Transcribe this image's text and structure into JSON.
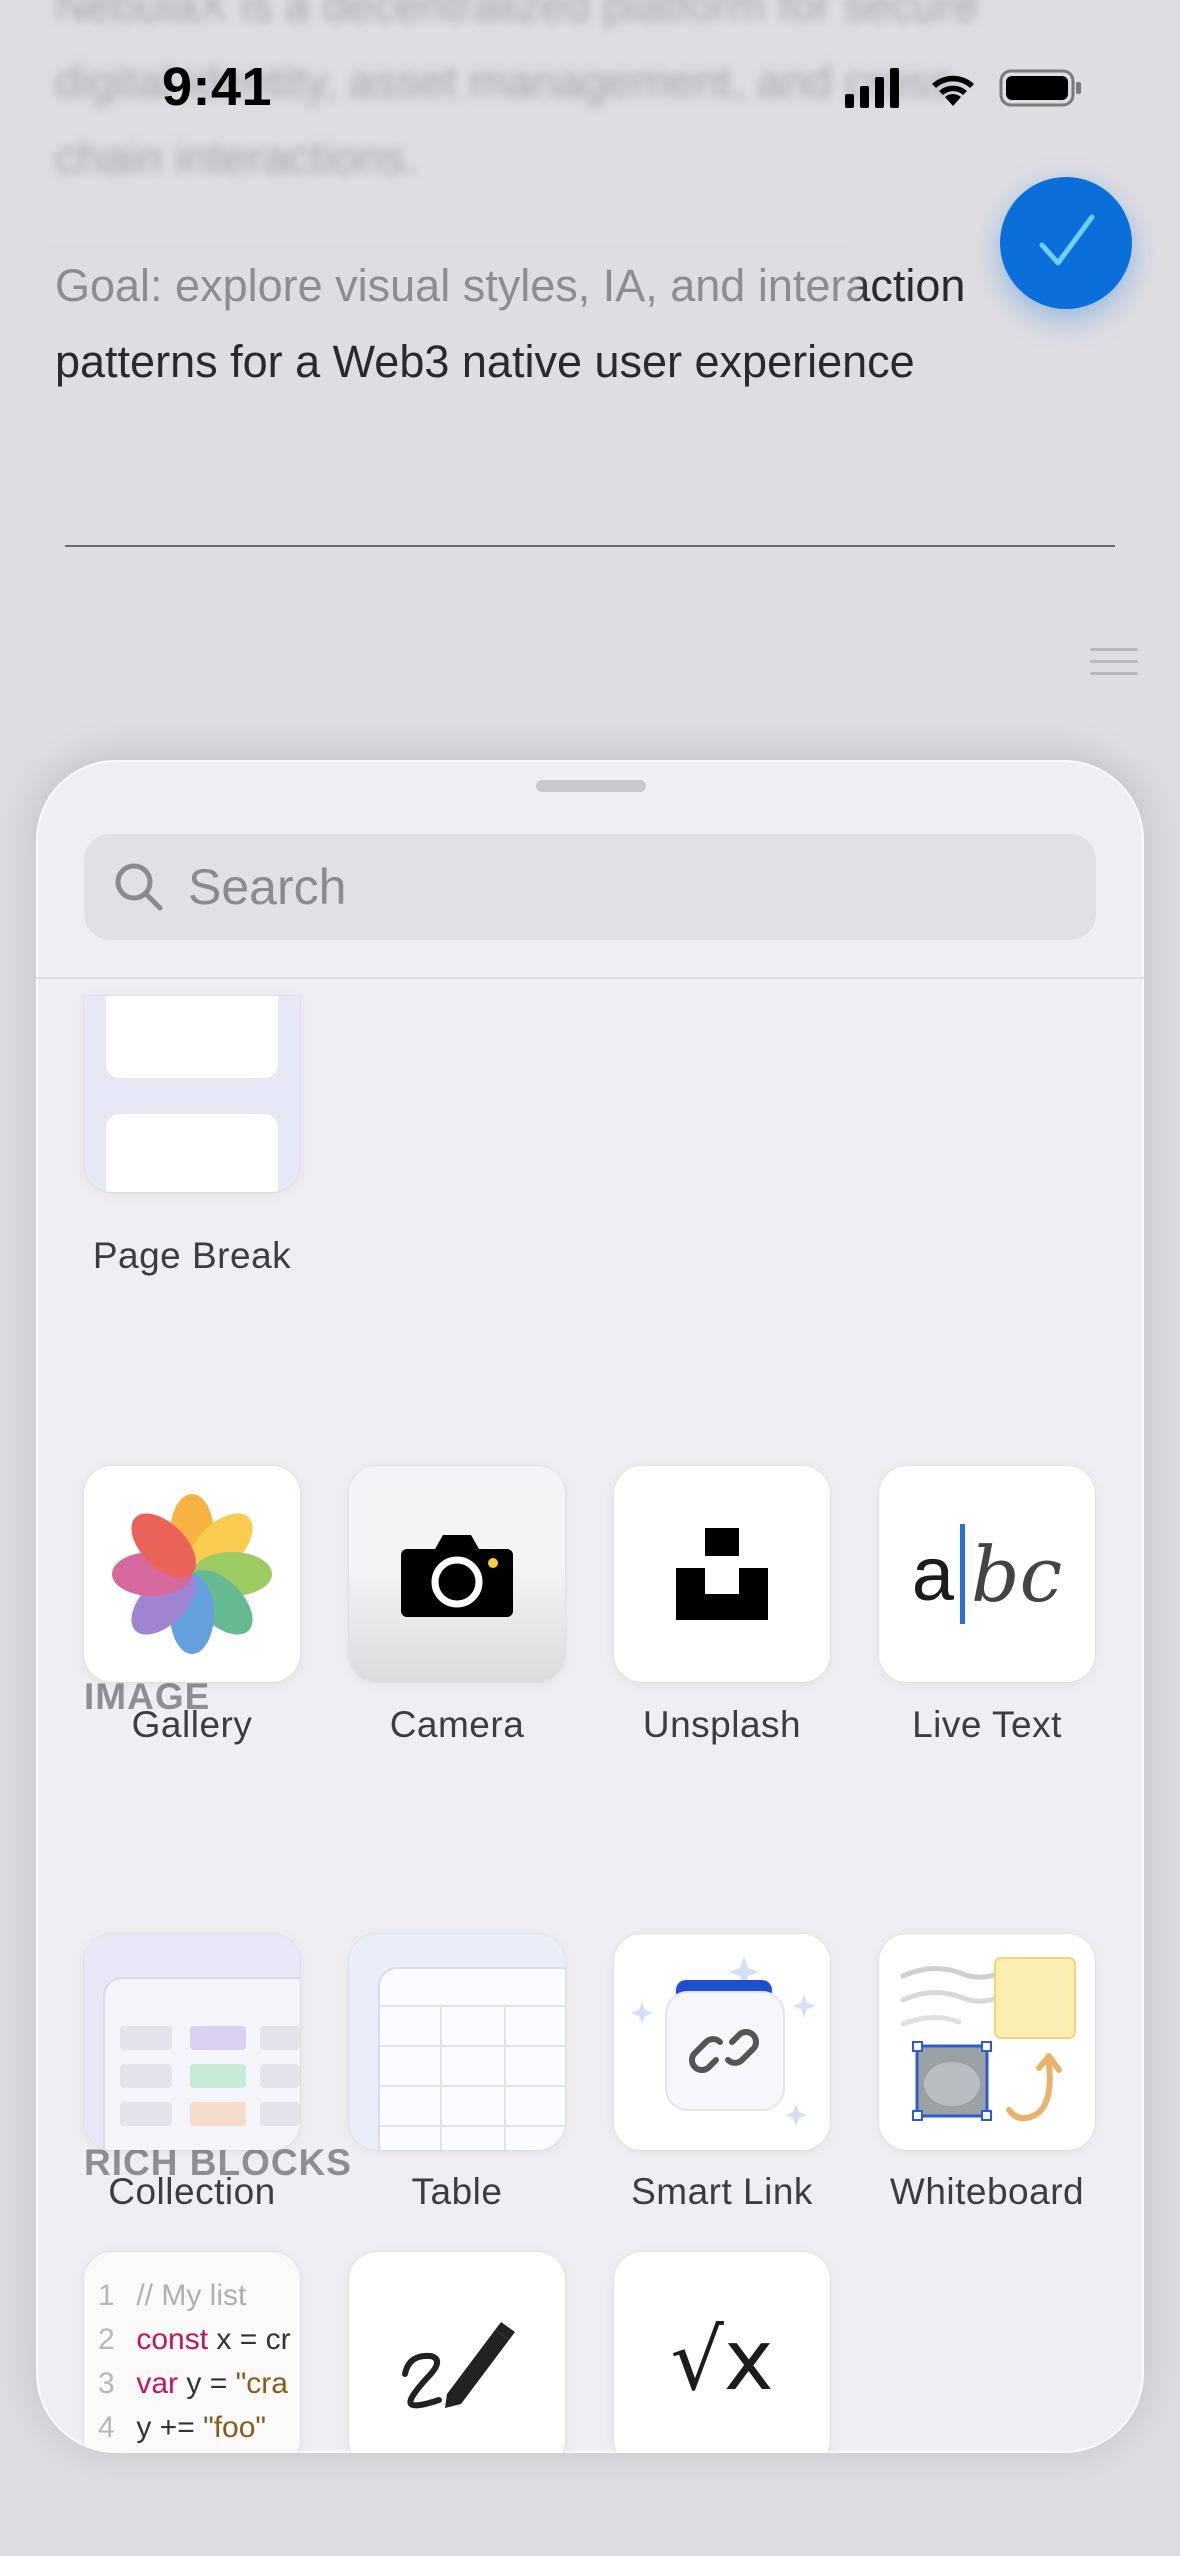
{
  "status_bar": {
    "time": "9:41"
  },
  "document": {
    "intro_text": "NebulaX is a decentralized platform for secure digital identity, asset management, and cross-chain interactions.",
    "goal_text": "Goal: explore visual styles, IA, and interaction patterns for a Web3 native user experience"
  },
  "sheet": {
    "search_placeholder": "Search",
    "sections": {
      "layout": {
        "items": [
          {
            "label": "Page Break",
            "icon": "page-break-icon"
          }
        ]
      },
      "image": {
        "title": "IMAGE",
        "items": [
          {
            "label": "Gallery",
            "icon": "photos-flower-icon"
          },
          {
            "label": "Camera",
            "icon": "camera-icon"
          },
          {
            "label": "Unsplash",
            "icon": "unsplash-icon"
          },
          {
            "label": "Live Text",
            "icon": "live-text-icon"
          }
        ]
      },
      "rich_blocks": {
        "title": "RICH BLOCKS",
        "items": [
          {
            "label": "Collection",
            "icon": "collection-icon"
          },
          {
            "label": "Table",
            "icon": "table-icon"
          },
          {
            "label": "Smart Link",
            "icon": "link-icon"
          },
          {
            "label": "Whiteboard",
            "icon": "whiteboard-icon"
          },
          {
            "label": "",
            "icon": "code-block-icon"
          },
          {
            "label": "",
            "icon": "sketch-pen-icon"
          },
          {
            "label": "",
            "icon": "math-formula-icon"
          }
        ]
      }
    },
    "code_preview": {
      "line1_num": "1",
      "line1": "// My list",
      "line2_num": "2",
      "line2_kw": "const",
      "line2": " x = cr",
      "line3_num": "3",
      "line3_kw": "var",
      "line3_a": " y = ",
      "line3_str": "\"cra",
      "line4_num": "4",
      "line4_a": "y += ",
      "line4_str": "\"foo\""
    },
    "live_text_glyphs": {
      "plain": "a",
      "script": "bc"
    },
    "math_glyph": "√x"
  },
  "colors": {
    "accent": "#0a6fdb",
    "section_title": "#8e8e93",
    "sheet_bg": "#efeef2"
  }
}
